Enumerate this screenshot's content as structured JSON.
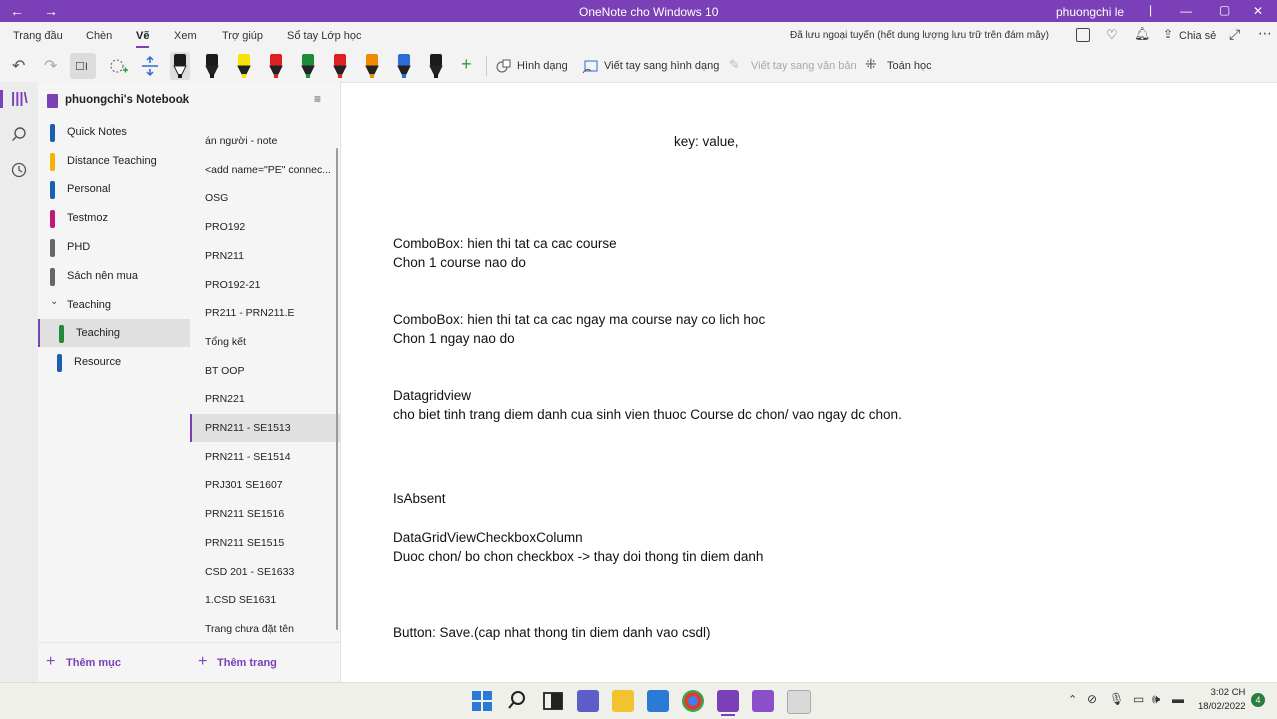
{
  "window": {
    "title": "OneNote cho Windows 10",
    "user": "phuongchi le",
    "back": "←",
    "forward": "→",
    "minimize": "—",
    "maximize": "▢",
    "close": "✕"
  },
  "ribbon": {
    "tabs": [
      "Trang đầu",
      "Chèn",
      "Vẽ",
      "Xem",
      "Trợ giúp",
      "Sổ tay Lớp học"
    ],
    "active_tab": "Vẽ",
    "status": "Đã lưu ngoại tuyến (hết dung lượng lưu trữ trên đám mây)",
    "share": "Chia sẻ"
  },
  "toolbar": {
    "shapes": "Hình dạng",
    "ink_to_shape": "Viết tay sang hình dạng",
    "ink_to_text": "Viết tay sang văn bản",
    "math": "Toán học",
    "pen_colors": [
      "#1a1a1a",
      "#1a1a1a",
      "#f5e400",
      "#e02020",
      "#1f8a3a",
      "#e02020",
      "#f08a00",
      "#2b6cd6",
      "#1a1a1a"
    ]
  },
  "notebook": {
    "name": "phuongchi's Notebook",
    "sections": [
      {
        "label": "Quick Notes",
        "color": "#1a5fb4"
      },
      {
        "label": "Distance Teaching",
        "color": "#f6b400"
      },
      {
        "label": "Personal",
        "color": "#1a5fb4"
      },
      {
        "label": "Testmoz",
        "color": "#c2187a"
      },
      {
        "label": "PHD",
        "color": "#666666"
      },
      {
        "label": "Sách nên mua",
        "color": "#666666"
      }
    ],
    "group": "Teaching",
    "group_sections": [
      {
        "label": "Teaching",
        "color": "#1f8a3a",
        "selected": true
      },
      {
        "label": "Resource",
        "color": "#1a5fb4",
        "selected": false
      }
    ],
    "add_section": "Thêm mục",
    "add_page": "Thêm trang"
  },
  "pages": [
    "án người - note",
    "<add name=\"PE\" connec...",
    "OSG",
    "PRO192",
    "PRN211",
    "PRO192-21",
    "PR211 - PRN211.E",
    "Tổng kết",
    "BT OOP",
    "PRN221",
    "PRN211 - SE1513",
    "PRN211 - SE1514",
    "PRJ301 SE1607",
    "PRN211 SE1516",
    "PRN211 SE1515",
    "CSD 201 - SE1633",
    "1.CSD SE1631",
    "Trang chưa đặt tên"
  ],
  "selected_page": "PRN211 - SE1513",
  "note": {
    "line1": "key: value,",
    "p1a": "ComboBox: hien thi tat ca cac course",
    "p1b": "Chon 1 course nao do",
    "p2a": "ComboBox: hien thi tat ca cac ngay ma course nay co lich hoc",
    "p2b": "Chon 1 ngay nao do",
    "p3a": "Datagridview",
    "p3b": "cho biet tinh trang diem danh cua sinh vien thuoc Course dc chon/ vao ngay dc chon.",
    "p4": "IsAbsent",
    "p5a": "DataGridViewCheckboxColumn",
    "p5b": "Duoc chon/ bo chon checkbox -> thay doi thong tin diem danh",
    "p6": "Button: Save.(cap nhat thong tin diem danh vao csdl)"
  },
  "taskbar": {
    "time": "3:02 CH",
    "date": "18/02/2022",
    "notifications": "4"
  }
}
